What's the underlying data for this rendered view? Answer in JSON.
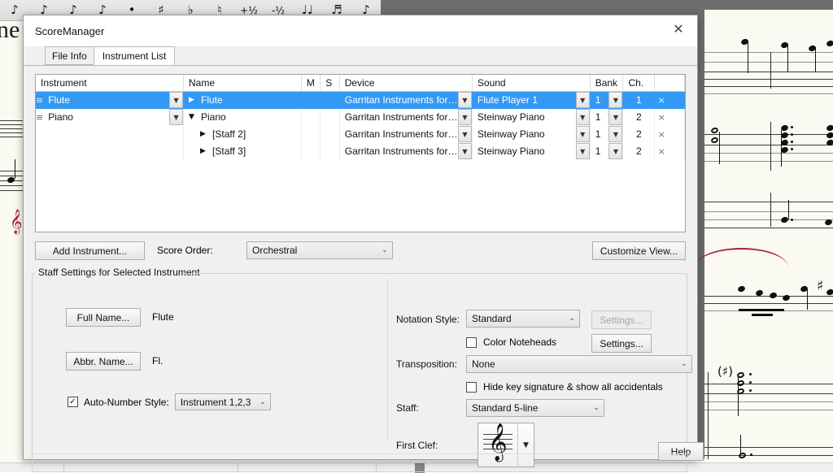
{
  "background": {
    "palette_items": [
      "♪",
      "♪",
      "♪",
      "♪",
      "•",
      "♯",
      "♭",
      "♮",
      "+½",
      "-½",
      "♩♩",
      "♬",
      "♪"
    ],
    "left_page_text": "ne"
  },
  "window": {
    "title": "ScoreManager",
    "close_icon": "close-icon",
    "close_glyph": "✕"
  },
  "tabs": [
    {
      "label": "File Info",
      "active": false
    },
    {
      "label": "Instrument List",
      "active": true
    }
  ],
  "table": {
    "columns": [
      "Instrument",
      "Name",
      "M",
      "S",
      "Device",
      "Sound",
      "Bank",
      "Ch.",
      ""
    ],
    "rows": [
      {
        "selected": true,
        "handle_icon": "drag-handle-icon",
        "handle_glyph": "≡",
        "instrument": "Flute",
        "expand_glyph": "▶",
        "name": "Flute",
        "m": "",
        "s": "",
        "device": "Garritan Instruments for ...",
        "sound": "Flute Player 1",
        "bank": "1",
        "channel": "1",
        "remove_glyph": "×"
      },
      {
        "selected": false,
        "handle_icon": "drag-handle-icon",
        "handle_glyph": "≡",
        "instrument": "Piano",
        "expand_glyph": "▼",
        "name": "Piano",
        "m": "",
        "s": "",
        "device": "Garritan Instruments for ...",
        "sound": "Steinway Piano",
        "bank": "1",
        "channel": "2",
        "remove_glyph": "×"
      },
      {
        "selected": false,
        "handle_icon": "",
        "handle_glyph": "",
        "instrument": "",
        "expand_glyph": "▶",
        "name": "[Staff 2]",
        "m": "",
        "s": "",
        "device": "Garritan Instruments for ...",
        "sound": "Steinway Piano",
        "bank": "1",
        "channel": "2",
        "remove_glyph": "×"
      },
      {
        "selected": false,
        "handle_icon": "",
        "handle_glyph": "",
        "instrument": "",
        "expand_glyph": "▶",
        "name": "[Staff 3]",
        "m": "",
        "s": "",
        "device": "Garritan Instruments for ...",
        "sound": "Steinway Piano",
        "bank": "1",
        "channel": "2",
        "remove_glyph": "×"
      }
    ]
  },
  "toolbar": {
    "add_instrument_label": "Add Instrument...",
    "score_order_label": "Score Order:",
    "score_order_value": "Orchestral",
    "customize_view_label": "Customize View..."
  },
  "staff_settings": {
    "legend": "Staff Settings for Selected Instrument",
    "full_name_button": "Full Name...",
    "full_name_value": "Flute",
    "abbr_name_button": "Abbr. Name...",
    "abbr_name_value": "Fl.",
    "auto_number_checked": true,
    "auto_number_label": "Auto-Number Style:",
    "auto_number_value": "Instrument 1,2,3",
    "notation_style_label": "Notation Style:",
    "notation_style_value": "Standard",
    "notation_settings_button": "Settings...",
    "color_noteheads_checked": false,
    "color_noteheads_label": "Color Noteheads",
    "color_noteheads_settings_button": "Settings...",
    "transposition_label": "Transposition:",
    "transposition_value": "None",
    "hide_key_checked": false,
    "hide_key_label": "Hide key signature & show all accidentals",
    "staff_label": "Staff:",
    "staff_value": "Standard 5-line",
    "first_clef_label": "First Clef:",
    "first_clef_glyph": "𝄞",
    "help_button": "Help"
  },
  "colors": {
    "selection": "#3399f5",
    "dialog_bg": "#f0f0f0",
    "score_paper": "#fbfaf2",
    "slur_accent": "#a61c43"
  },
  "glyphs": {
    "checkmark": "✓",
    "chevron_down": "⌄",
    "arrow_down_small": "▼",
    "triangle_right": "▶"
  }
}
